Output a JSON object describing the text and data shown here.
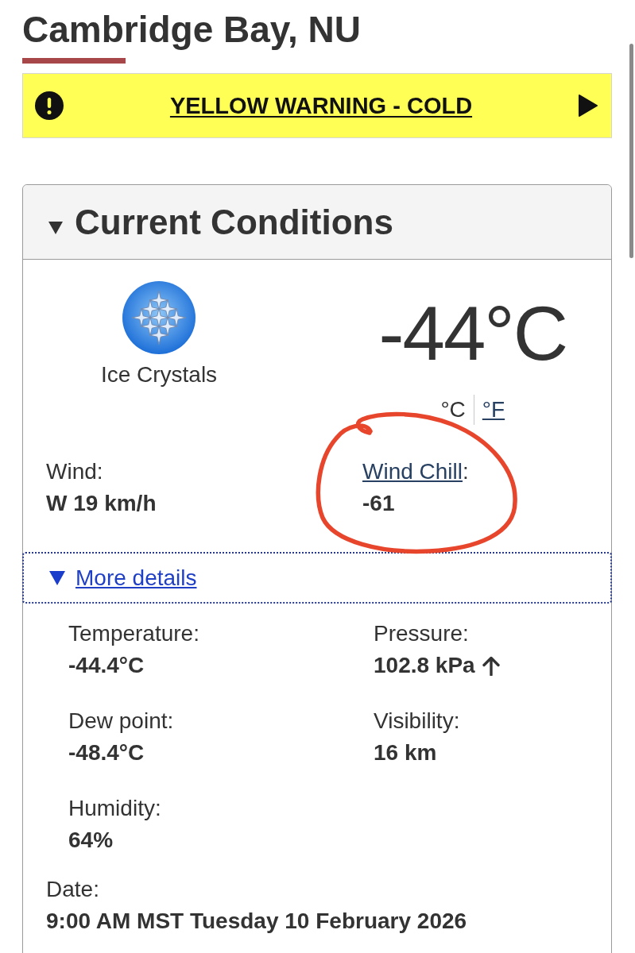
{
  "page": {
    "title": "Cambridge Bay, NU"
  },
  "alert": {
    "text": "YELLOW WARNING - COLD"
  },
  "current_conditions": {
    "title": "Current Conditions",
    "expanded": true,
    "condition": {
      "label": "Ice Crystals"
    },
    "temperature": "-44°C",
    "units": [
      {
        "label": "°C",
        "selected": true
      },
      {
        "label": "°F",
        "selected": false
      }
    ],
    "summary": [
      {
        "label": "Wind",
        "suffix": ":",
        "link": false,
        "highlighted": false,
        "value": "W 19 km/h"
      },
      {
        "label": "Wind Chill",
        "suffix": ":",
        "link": true,
        "highlighted": true,
        "value": "-61"
      }
    ],
    "more_details": {
      "label": "More details",
      "expanded": true,
      "items": [
        {
          "label": "Temperature:",
          "value": "-44.4°C",
          "rising": false
        },
        {
          "label": "Pressure:",
          "value": "102.8 kPa",
          "rising": true
        },
        {
          "label": "Dew point:",
          "value": "-48.4°C",
          "rising": false
        },
        {
          "label": "Visibility:",
          "value": "16 km",
          "rising": false
        },
        {
          "label": "Humidity:",
          "value": "64%",
          "rising": false
        }
      ]
    },
    "date": {
      "label": "Date:",
      "value": "9:00 AM MST Tuesday 10 February 2026"
    }
  }
}
